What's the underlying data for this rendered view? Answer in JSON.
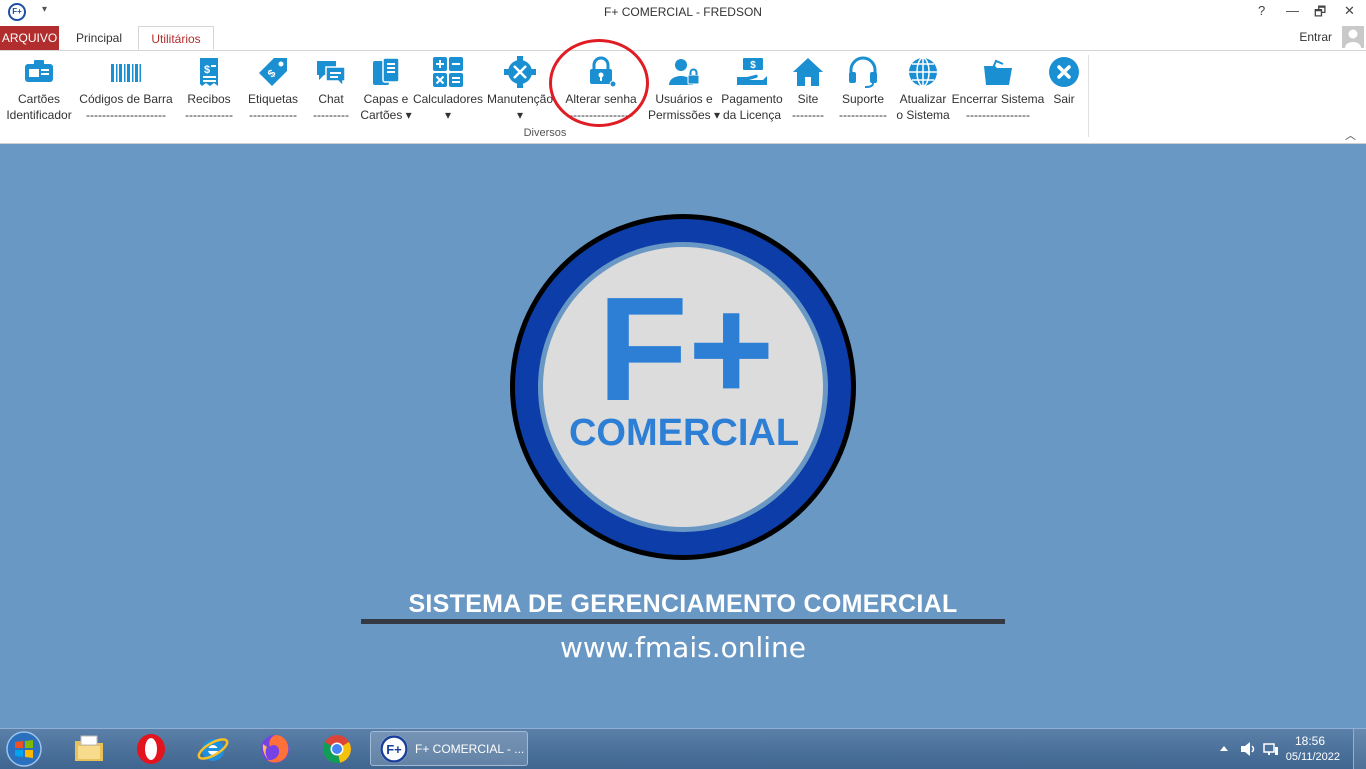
{
  "window": {
    "app_icon_text": "F+",
    "quick_access": "▾",
    "title": "F+ COMERCIAL - FREDSON",
    "help": "?",
    "minimize": "—",
    "restore": "🗗",
    "close": "✕"
  },
  "tabs": {
    "arquivo": "ARQUIVO",
    "principal": "Principal",
    "utilitarios": "Utilitários",
    "signin": "Entrar"
  },
  "ribbon": {
    "group_name": "Diversos",
    "collapse": "︿",
    "buttons": [
      {
        "label1": "Cartões",
        "label2": "Identificador",
        "icon": "id-card-icon"
      },
      {
        "label1": "Códigos de Barra",
        "label2": "--------------------",
        "icon": "barcode-icon"
      },
      {
        "label1": "Recibos",
        "label2": "------------",
        "icon": "receipt-icon"
      },
      {
        "label1": "Etiquetas",
        "label2": "------------",
        "icon": "tag-icon"
      },
      {
        "label1": "Chat",
        "label2": "---------",
        "icon": "chat-icon"
      },
      {
        "label1": "Capas e",
        "label2": "Cartões ▾",
        "icon": "cards-icon"
      },
      {
        "label1": "Calculadores",
        "label2": "▾",
        "icon": "calculator-icon"
      },
      {
        "label1": "Manutenção",
        "label2": "▾",
        "icon": "maintenance-icon"
      },
      {
        "label1": "Alterar senha",
        "label2": "----------------",
        "icon": "lock-icon"
      },
      {
        "label1": "Usuários e",
        "label2": "Permissões ▾",
        "icon": "user-lock-icon"
      },
      {
        "label1": "Pagamento",
        "label2": "da Licença",
        "icon": "payment-icon"
      },
      {
        "label1": "Site",
        "label2": "--------",
        "icon": "home-icon"
      },
      {
        "label1": "Suporte",
        "label2": "------------",
        "icon": "headset-icon"
      },
      {
        "label1": "Atualizar",
        "label2": "o Sistema",
        "icon": "globe-icon"
      },
      {
        "label1": "Encerrar Sistema",
        "label2": "----------------",
        "icon": "folder-icon"
      },
      {
        "label1": "Sair",
        "label2": "",
        "icon": "close-circle-icon"
      }
    ]
  },
  "logo": {
    "big": "F+",
    "name": "COMERCIAL"
  },
  "main": {
    "slogan": "SISTEMA DE GERENCIAMENTO COMERCIAL",
    "website": "www.fmais.online"
  },
  "taskbar": {
    "task_label": "F+ COMERCIAL - ...",
    "time": "18:56",
    "date": "05/11/2022"
  },
  "colors": {
    "accent_red": "#b22d2d",
    "icon_blue": "#1a8fd1",
    "background": "#6a98c4",
    "highlight": "#e01c24"
  }
}
